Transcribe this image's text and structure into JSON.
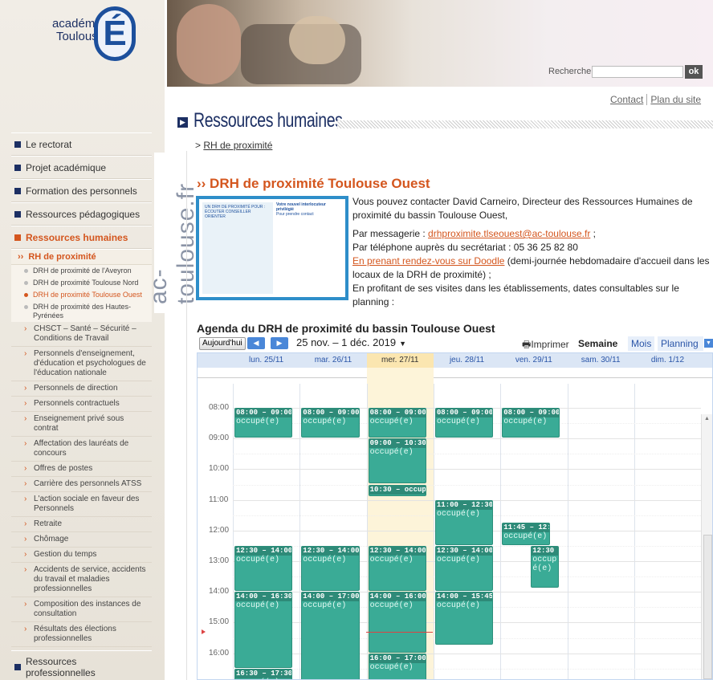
{
  "header": {
    "logo_line1": "académie",
    "logo_line2": "Toulouse",
    "logo_letter": "É",
    "vertical_brand": "ac-toulouse.fr",
    "search_label": "Recherche",
    "search_button": "ok",
    "links": [
      "Contact",
      "Plan du site"
    ]
  },
  "page": {
    "title": "Ressources humaines",
    "breadcrumb": "RH de proximité",
    "heading": "DRH de proximité Toulouse Ouest",
    "intro1": "Vous pouvez contacter David Carneiro, Directeur des Ressources Humaines de proximité du bassin Toulouse Ouest,",
    "mail_label": "Par messagerie : ",
    "mail_link": "drhproximite.tlseouest@ac-toulouse.fr",
    "mail_after": " ;",
    "phone": "Par téléphone auprès du secrétariat : 05 36 25 82 80",
    "doodle_link": "En prenant rendez-vous sur Doodle",
    "doodle_after": " (demi-journée hebdomadaire d'accueil dans les locaux de la DRH de proximité) ;",
    "visits": "En profitant de ses visites dans les établissements, dates consultables sur le planning :",
    "flyer_title": "Votre nouvel interlocuteur privilégié",
    "flyer_left": "UN DRH DE PROXIMITÉ POUR : ÉCOUTER CONSEILLER ORIENTER",
    "flyer_right": "Pour prendre contact"
  },
  "sidebar": {
    "main_top": [
      "Le rectorat",
      "Projet académique",
      "Formation des personnels",
      "Ressources pédagogiques",
      "Ressources humaines"
    ],
    "sub_active": "RH de proximité",
    "sub2": [
      "DRH de proximité de l'Aveyron",
      "DRH de proximité Toulouse Nord",
      "DRH de proximité Toulouse Ouest",
      "DRH de proximité des Hautes-Pyrénées"
    ],
    "sections": [
      "CHSCT – Santé – Sécurité – Conditions de Travail",
      "Personnels d'enseignement, d'éducation et psychologues de l'éducation nationale",
      "Personnels de direction",
      "Personnels contractuels",
      "Enseignement privé sous contrat",
      "Affectation des lauréats de concours",
      "Offres de postes",
      "Carrière des personnels ATSS",
      "L'action sociale en faveur des Personnels",
      "Retraite",
      "Chômage",
      "Gestion du temps",
      "Accidents de service, accidents du travail et maladies professionnelles",
      "Composition des instances de consultation",
      "Résultats des élections professionnelles"
    ],
    "main_bottom": "Ressources professionnelles"
  },
  "calendar": {
    "title": "Agenda du DRH de proximité du bassin Toulouse Ouest",
    "today": "Aujourd'hui",
    "prev": "◀",
    "next": "▶",
    "range": "25 nov. – 1 déc. 2019",
    "print": "Imprimer",
    "tabs": [
      "Semaine",
      "Mois",
      "Planning"
    ],
    "days": [
      "lun. 25/11",
      "mar. 26/11",
      "mer. 27/11",
      "jeu. 28/11",
      "ven. 29/11",
      "sam. 30/11",
      "dim. 1/12"
    ],
    "hours": [
      "08:00",
      "09:00",
      "10:00",
      "11:00",
      "12:00",
      "13:00",
      "14:00",
      "15:00",
      "16:00"
    ],
    "busy": "occupé(e)",
    "events": [
      {
        "day": 0,
        "start": 8,
        "end": 9,
        "time": "08:00 – 09:00"
      },
      {
        "day": 1,
        "start": 8,
        "end": 9,
        "time": "08:00 – 09:00"
      },
      {
        "day": 2,
        "start": 8,
        "end": 9,
        "time": "08:00 – 09:00"
      },
      {
        "day": 3,
        "start": 8,
        "end": 9,
        "time": "08:00 – 09:00"
      },
      {
        "day": 4,
        "start": 8,
        "end": 9,
        "time": "08:00 – 09:00"
      },
      {
        "day": 2,
        "start": 9,
        "end": 10.5,
        "time": "09:00 – 10:30"
      },
      {
        "day": 2,
        "start": 10.5,
        "end": 10.9,
        "time": "10:30 – occupé("
      },
      {
        "day": 3,
        "start": 11,
        "end": 12.5,
        "time": "11:00 – 12:30"
      },
      {
        "day": 4,
        "start": 11.75,
        "end": 12.5,
        "time": "11:45 – 12:4"
      },
      {
        "day": 0,
        "start": 12.5,
        "end": 14,
        "time": "12:30 – 14:00"
      },
      {
        "day": 1,
        "start": 12.5,
        "end": 14,
        "time": "12:30 – 14:00"
      },
      {
        "day": 2,
        "start": 12.5,
        "end": 14,
        "time": "12:30 – 14:00"
      },
      {
        "day": 3,
        "start": 12.5,
        "end": 14,
        "time": "12:30 – 14:00"
      },
      {
        "day": 4,
        "start": 12.5,
        "end": 13.9,
        "time": "12:30 –",
        "narrow": true,
        "busy": "occup é(e)"
      },
      {
        "day": 0,
        "start": 14,
        "end": 16.5,
        "time": "14:00 – 16:30"
      },
      {
        "day": 1,
        "start": 14,
        "end": 17,
        "time": "14:00 – 17:00"
      },
      {
        "day": 2,
        "start": 14,
        "end": 16,
        "time": "14:00 – 16:00"
      },
      {
        "day": 3,
        "start": 14,
        "end": 15.75,
        "time": "14:00 – 15:45"
      },
      {
        "day": 2,
        "start": 16,
        "end": 17,
        "time": "16:00 – 17:00"
      },
      {
        "day": 0,
        "start": 16.5,
        "end": 17.5,
        "time": "16:30 – 17:30"
      }
    ]
  }
}
